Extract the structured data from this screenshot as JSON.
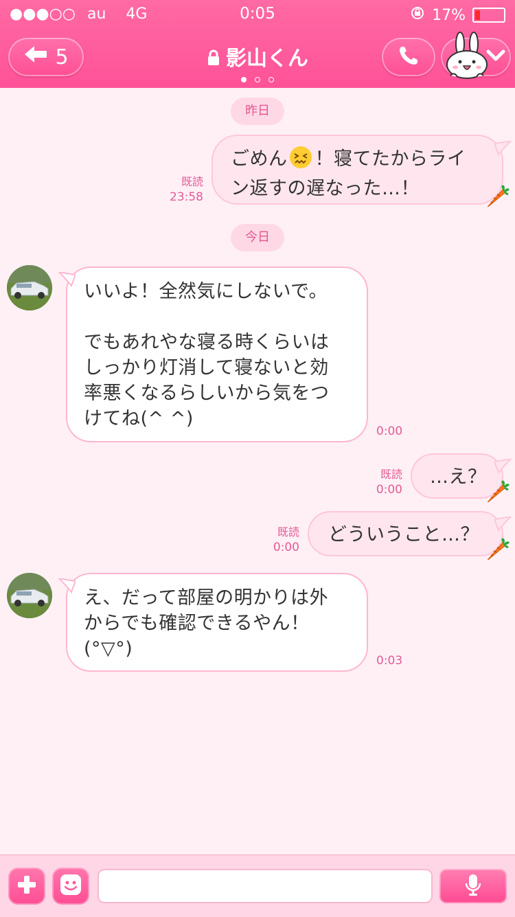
{
  "status": {
    "signal": "●●●○○",
    "carrier": "au",
    "network": "4G",
    "time": "0:05",
    "battery_text": "17%",
    "battery_level": 0.17
  },
  "header": {
    "back_count": "5",
    "title": "影山くん"
  },
  "chat": {
    "date_yesterday": "昨日",
    "date_today": "今日",
    "m1": {
      "line1_a": "ごめん",
      "line1_b": "！寝てたからライ",
      "line2": "ン返すの遅なった…！",
      "read": "既読",
      "time": "23:58"
    },
    "m2": {
      "lines": [
        "いいよ！全然気にしないで。",
        "",
        "でもあれやな寝る時くらいは",
        "しっかり灯消して寝ないと効",
        "率悪くなるらしいから気をつ",
        "けてね(^ ^)"
      ],
      "time": "0:00"
    },
    "m3": {
      "text": "…え？",
      "read": "既読",
      "time": "0:00"
    },
    "m4": {
      "text": "どういうこと…？",
      "read": "既読",
      "time": "0:00"
    },
    "m5": {
      "lines": [
        "え、だって部屋の明かりは外",
        "からでも確認できるやん！",
        "(°▽°)"
      ],
      "time": "0:03"
    }
  },
  "colors": {
    "accent": "#ff5a9d",
    "background": "#fff0f6",
    "out_bubble": "#ffe6ee",
    "in_bubble": "#ffffff",
    "meta": "#e25c94"
  },
  "icons": [
    "back-arrow-icon",
    "lock-icon",
    "phone-icon",
    "bunny-icon",
    "chevron-down-icon",
    "carrot-icon",
    "plus-icon",
    "emoji-icon",
    "mic-icon"
  ],
  "input": {
    "value": ""
  }
}
